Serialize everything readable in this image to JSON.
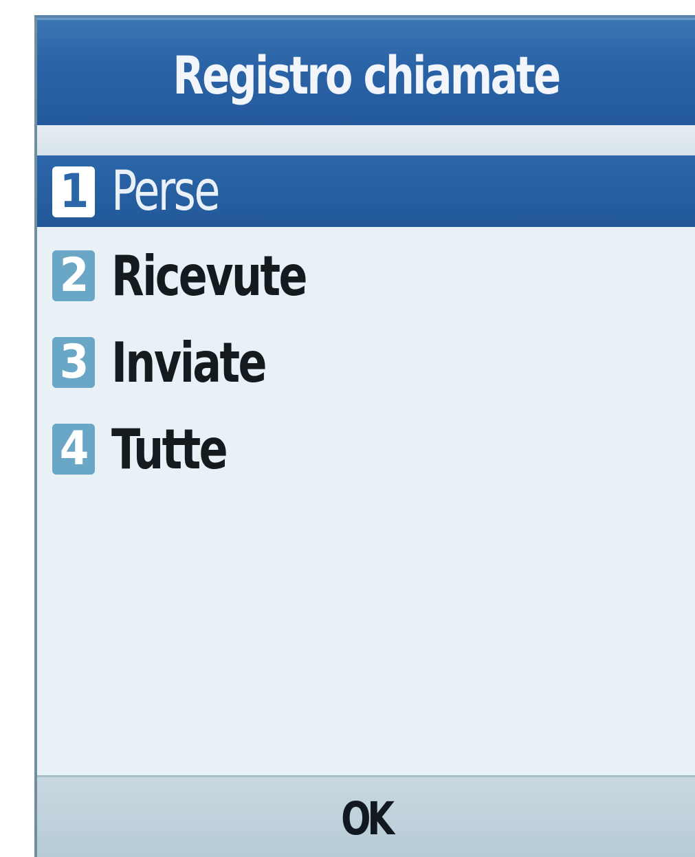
{
  "screen": {
    "title": "Registro chiamate"
  },
  "menu": {
    "items": [
      {
        "number": "1",
        "label": "Perse",
        "selected": true
      },
      {
        "number": "2",
        "label": "Ricevute",
        "selected": false
      },
      {
        "number": "3",
        "label": "Inviate",
        "selected": false
      },
      {
        "number": "4",
        "label": "Tutte",
        "selected": false
      }
    ]
  },
  "softkeys": {
    "center_label": "OK"
  },
  "colors": {
    "title_bar": "#2a63a6",
    "selection": "#2c67aa",
    "background": "#e8f1f5",
    "number_badge": "#6aa6c6",
    "softkey_bar": "#c0d2dc"
  }
}
